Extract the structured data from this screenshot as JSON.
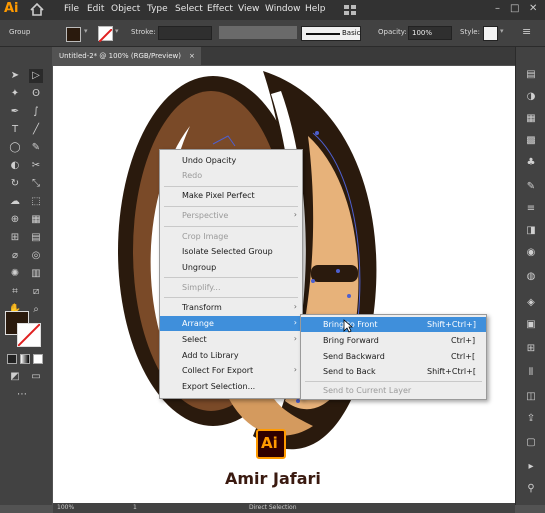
{
  "app": {
    "logo": "Ai",
    "menu": [
      "File",
      "Edit",
      "Object",
      "Type",
      "Select",
      "Effect",
      "View",
      "Window",
      "Help"
    ]
  },
  "control_bar": {
    "selection_label": "Group",
    "stroke_label": "Stroke:",
    "brush_label": "Basic",
    "opacity_label": "Opacity:",
    "opacity_value": "100%",
    "style_label": "Style:"
  },
  "tab": {
    "title": "Untitled-2* @ 100% (RGB/Preview)",
    "close": "×"
  },
  "context_menu": {
    "items": [
      {
        "label": "Undo Opacity",
        "enabled": true
      },
      {
        "label": "Redo",
        "enabled": false
      },
      {
        "label": "Make Pixel Perfect",
        "enabled": true
      },
      {
        "label": "Perspective",
        "enabled": false,
        "submenu": true
      },
      {
        "label": "Crop Image",
        "enabled": false
      },
      {
        "label": "Isolate Selected Group",
        "enabled": true
      },
      {
        "label": "Ungroup",
        "enabled": true
      },
      {
        "label": "Simplify...",
        "enabled": false
      },
      {
        "label": "Transform",
        "enabled": true,
        "submenu": true
      },
      {
        "label": "Arrange",
        "enabled": true,
        "submenu": true,
        "highlighted": true
      },
      {
        "label": "Select",
        "enabled": true,
        "submenu": true
      },
      {
        "label": "Add to Library",
        "enabled": true
      },
      {
        "label": "Collect For Export",
        "enabled": true,
        "submenu": true
      },
      {
        "label": "Export Selection...",
        "enabled": true
      }
    ]
  },
  "arrange_submenu": {
    "items": [
      {
        "label": "Bring to Front",
        "shortcut": "Shift+Ctrl+]",
        "highlighted": true
      },
      {
        "label": "Bring Forward",
        "shortcut": "Ctrl+]"
      },
      {
        "label": "Send Backward",
        "shortcut": "Ctrl+["
      },
      {
        "label": "Send to Back",
        "shortcut": "Shift+Ctrl+["
      },
      {
        "label": "Send to Current Layer",
        "shortcut": "",
        "enabled": false
      }
    ]
  },
  "status": {
    "zoom": "100%",
    "artboard": "1",
    "tool": "Direct Selection"
  },
  "watermark": {
    "logo_text": "Ai",
    "credit": "Amir Jafari"
  },
  "colors": {
    "accent": "#ff9a00",
    "highlight": "#3f8fdb",
    "bean_dark": "#2a1a0d",
    "bean_mid": "#7a4a28",
    "bean_light": "#e7b27a"
  }
}
